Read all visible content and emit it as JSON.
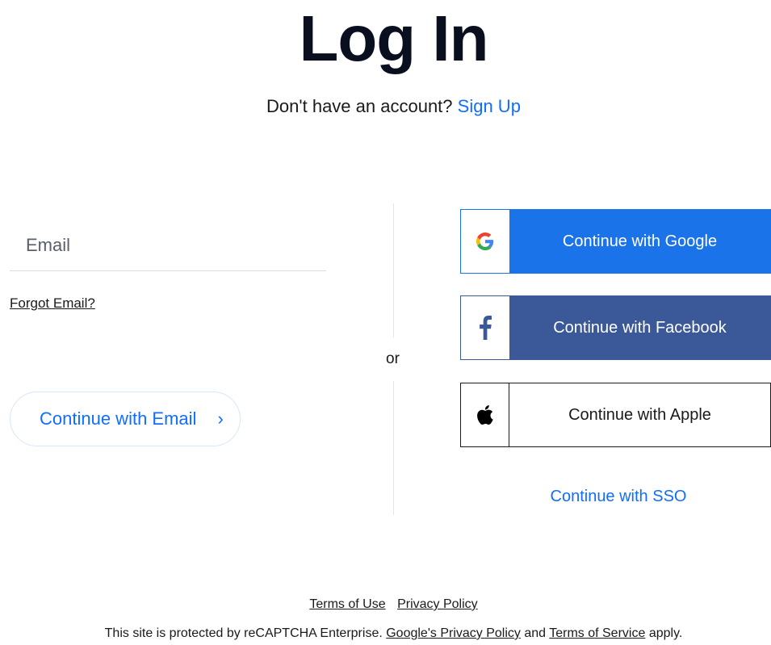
{
  "header": {
    "title": "Log In",
    "prompt_text": "Don't have an account?",
    "signup_link": "Sign Up"
  },
  "email_form": {
    "email_placeholder": "Email",
    "email_value": "",
    "forgot_email_link": "Forgot Email?",
    "continue_label": "Continue with Email",
    "continue_chevron": "›"
  },
  "divider": {
    "or_label": "or"
  },
  "social": {
    "google": {
      "label": "Continue with Google",
      "icon": "google-icon",
      "color": "#1a73e8"
    },
    "facebook": {
      "label": "Continue with Facebook",
      "icon": "facebook-icon",
      "color": "#3b5998"
    },
    "apple": {
      "label": "Continue with Apple",
      "icon": "apple-icon",
      "color": "#ffffff"
    },
    "sso_link": "Continue with SSO"
  },
  "footer": {
    "terms_link": "Terms of Use",
    "privacy_link": "Privacy Policy",
    "recaptcha_prefix": "This site is protected by reCAPTCHA Enterprise.",
    "google_privacy_link": "Google's Privacy Policy",
    "and_text": "and",
    "terms_service_link": "Terms of Service",
    "apply_text": "apply."
  },
  "colors": {
    "accent": "#116dff",
    "text": "#0a0f1f"
  }
}
